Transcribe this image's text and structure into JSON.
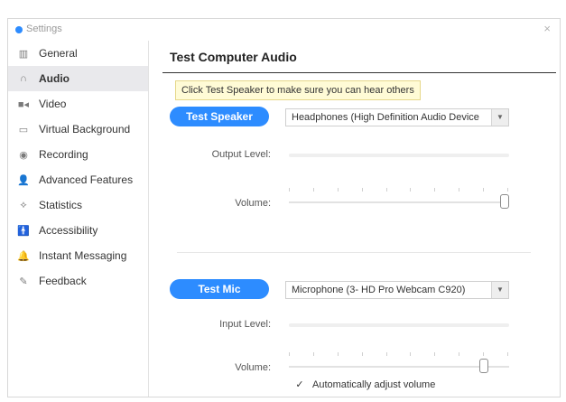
{
  "window": {
    "title": "Settings",
    "close_glyph": "×"
  },
  "sidebar": {
    "items": [
      {
        "label": "General",
        "icon": "gear-icon",
        "glyph": "▥"
      },
      {
        "label": "Audio",
        "icon": "headphones-icon",
        "glyph": "∩"
      },
      {
        "label": "Video",
        "icon": "video-camera-icon",
        "glyph": "■◂"
      },
      {
        "label": "Virtual Background",
        "icon": "image-icon",
        "glyph": "▭"
      },
      {
        "label": "Recording",
        "icon": "record-icon",
        "glyph": "◉"
      },
      {
        "label": "Advanced Features",
        "icon": "user-icon",
        "glyph": "👤"
      },
      {
        "label": "Statistics",
        "icon": "pulse-icon",
        "glyph": "⟡"
      },
      {
        "label": "Accessibility",
        "icon": "accessibility-icon",
        "glyph": "🚹"
      },
      {
        "label": "Instant Messaging",
        "icon": "bell-icon",
        "glyph": "🔔"
      },
      {
        "label": "Feedback",
        "icon": "feedback-icon",
        "glyph": "✎"
      }
    ],
    "active_index": 1
  },
  "audio": {
    "title": "Test Computer Audio",
    "tooltip": "Click Test Speaker to make sure you can hear others",
    "speaker": {
      "button": "Test Speaker",
      "device": "Headphones (High Definition Audio Device",
      "output_level_label": "Output Level:",
      "volume_label": "Volume:",
      "volume": 1.0
    },
    "mic": {
      "button": "Test Mic",
      "device": "Microphone (3- HD Pro Webcam C920)",
      "input_level_label": "Input Level:",
      "volume_label": "Volume:",
      "volume": 0.9
    },
    "auto_adjust": {
      "label": "Automatically adjust volume",
      "checked": true,
      "check_glyph": "✓"
    }
  },
  "colors": {
    "accent": "#2d8cff",
    "active_bg": "#e9e9ec"
  }
}
